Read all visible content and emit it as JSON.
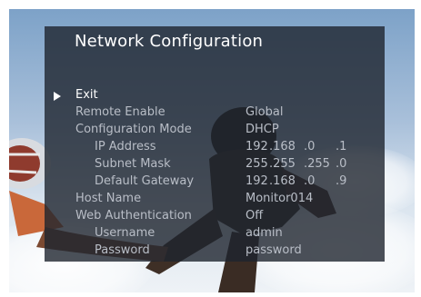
{
  "osd": {
    "title": "Network Configuration",
    "items": [
      {
        "label": "Exit"
      },
      {
        "label": "Remote Enable",
        "value": "Global"
      },
      {
        "label": "Configuration Mode",
        "value": "DHCP"
      },
      {
        "label": "IP Address",
        "octets": [
          "192",
          ".168",
          ".0",
          ".1"
        ]
      },
      {
        "label": "Subnet Mask",
        "octets": [
          "255",
          ".255",
          ".255",
          ".0"
        ]
      },
      {
        "label": "Default Gateway",
        "octets": [
          "192",
          ".168",
          ".0",
          ".9"
        ]
      },
      {
        "label": "Host Name",
        "value": "Monitor014"
      },
      {
        "label": "Web Authentication",
        "value": "Off"
      },
      {
        "label": "Username",
        "value": "admin"
      },
      {
        "label": "Password",
        "value": "password"
      }
    ]
  },
  "colors": {
    "panel": "#1e242e",
    "selected_text": "#ffffff",
    "dim_text": "#b9bec7"
  },
  "icons": {
    "selection": "play-arrow-icon"
  }
}
